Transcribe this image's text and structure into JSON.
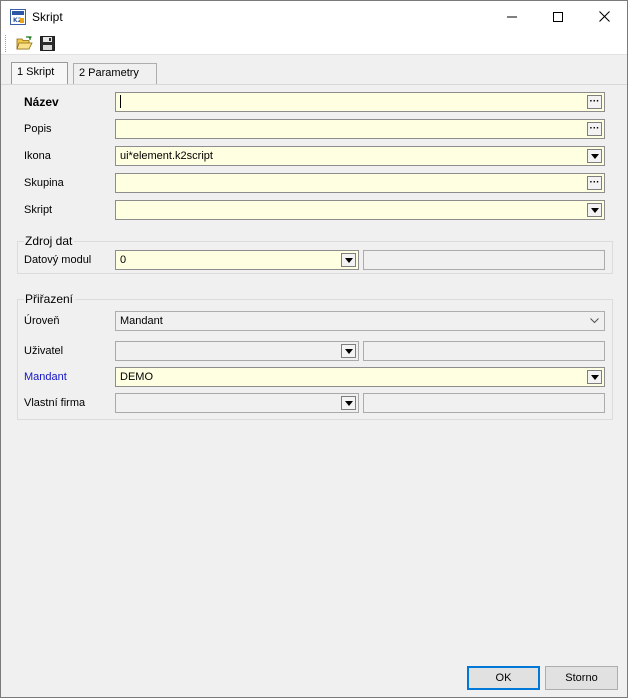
{
  "window": {
    "title": "Skript",
    "icon": "k2-app-icon"
  },
  "toolbar": {
    "items": [
      {
        "name": "open-folder-icon"
      },
      {
        "name": "save-disk-icon"
      }
    ]
  },
  "tabs": [
    {
      "label": "1 Skript",
      "active": true
    },
    {
      "label": "2 Parametry",
      "active": false
    }
  ],
  "form": {
    "nazev": {
      "label": "Název",
      "value": ""
    },
    "popis": {
      "label": "Popis",
      "value": ""
    },
    "ikona": {
      "label": "Ikona",
      "value": "ui*element.k2script"
    },
    "skupina": {
      "label": "Skupina",
      "value": ""
    },
    "skript": {
      "label": "Skript",
      "value": ""
    }
  },
  "zdroj_dat": {
    "title": "Zdroj dat",
    "datovy_modul": {
      "label": "Datový modul",
      "value": "0",
      "extra": ""
    }
  },
  "prirazeni": {
    "title": "Přiřazení",
    "uroven": {
      "label": "Úroveň",
      "value": "Mandant"
    },
    "uzivatel": {
      "label": "Uživatel",
      "value": "",
      "extra": ""
    },
    "mandant": {
      "label": "Mandant",
      "value": "DEMO"
    },
    "vlastni_firma": {
      "label": "Vlastní firma",
      "value": "",
      "extra": ""
    }
  },
  "buttons": {
    "ok": "OK",
    "storno": "Storno"
  },
  "colors": {
    "field_bg": "#ffffe1",
    "mandant_label": "#1414c8",
    "default_button_border": "#0078d7"
  }
}
